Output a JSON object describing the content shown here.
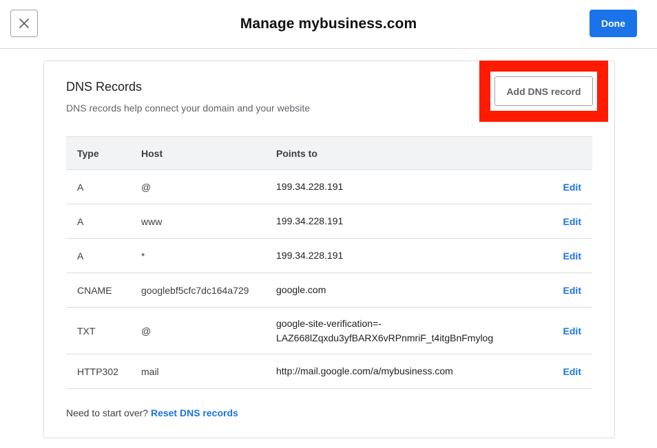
{
  "header": {
    "title": "Manage mybusiness.com",
    "close_icon": "close-icon",
    "done_label": "Done",
    "accent_color": "#1a73e8"
  },
  "dns": {
    "title": "DNS Records",
    "subtitle": "DNS records help connect your domain and your website",
    "add_label": "Add DNS record",
    "highlight_color": "#ff1a00",
    "columns": [
      "Type",
      "Host",
      "Points to",
      ""
    ],
    "rows": [
      {
        "type": "A",
        "host": "@",
        "points_to": "199.34.228.191",
        "action": "Edit"
      },
      {
        "type": "A",
        "host": "www",
        "points_to": "199.34.228.191",
        "action": "Edit"
      },
      {
        "type": "A",
        "host": "*",
        "points_to": "199.34.228.191",
        "action": "Edit"
      },
      {
        "type": "CNAME",
        "host": "googlebf5cfc7dc164a729",
        "points_to": "google.com",
        "action": "Edit"
      },
      {
        "type": "TXT",
        "host": "@",
        "points_to": "google-site-verification=-LAZ668lZqxdu3yfBARX6vRPnmriF_t4itgBnFmylog",
        "action": "Edit"
      },
      {
        "type": "HTTP302",
        "host": "mail",
        "points_to": "http://mail.google.com/a/mybusiness.com",
        "action": "Edit"
      }
    ]
  },
  "footer": {
    "prompt": "Need to start over?",
    "reset_label": "Reset DNS records"
  }
}
